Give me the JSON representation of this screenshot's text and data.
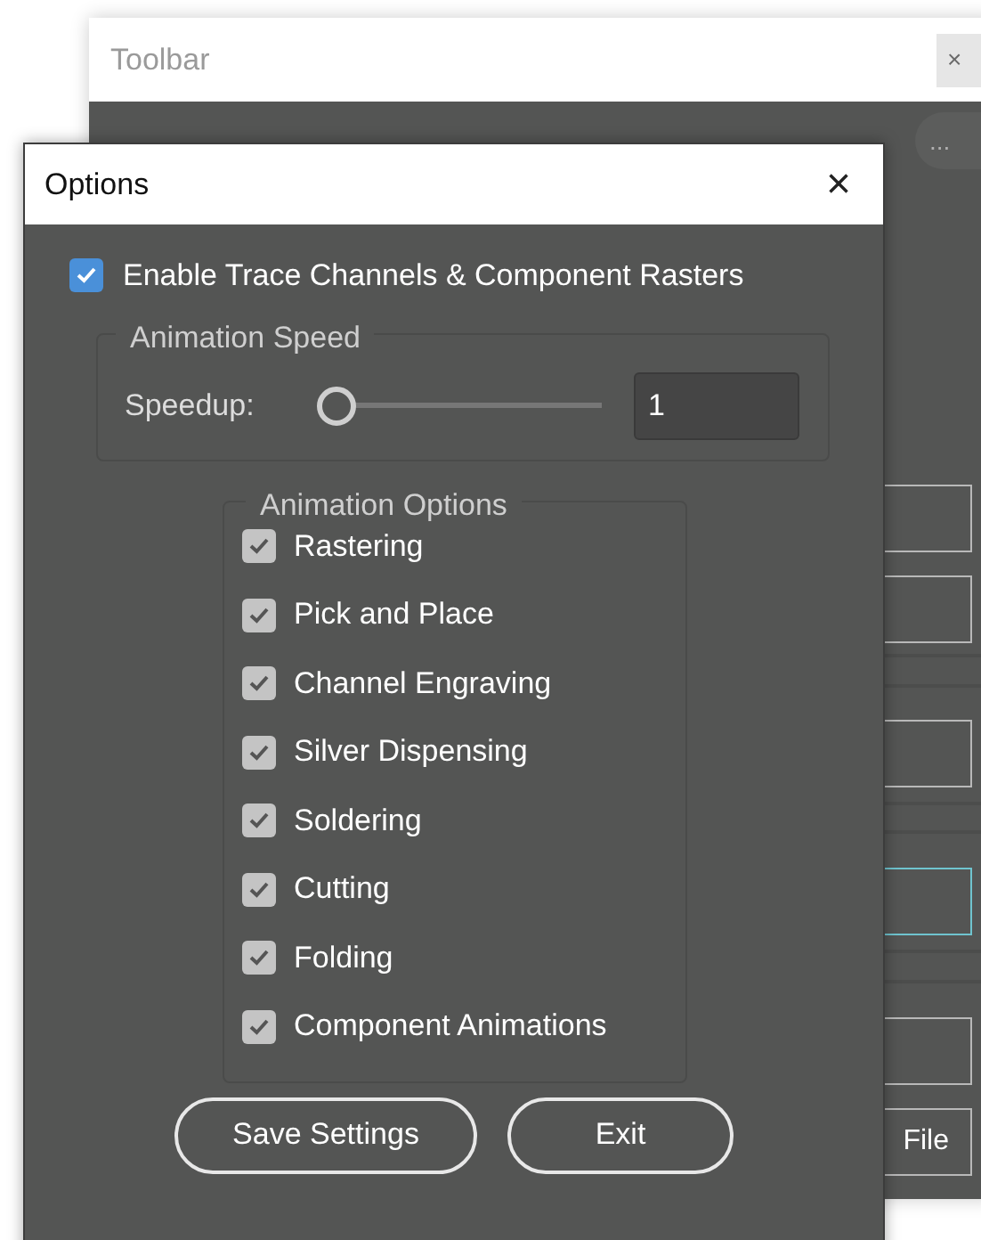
{
  "toolbar_window": {
    "title": "Toolbar",
    "close": "×",
    "more_button": "...",
    "buttons": [
      {
        "focused": false
      },
      {
        "focused": false
      },
      {
        "focused": false
      },
      {
        "focused": true
      },
      {
        "focused": false
      },
      {
        "focused": false,
        "label": "File"
      }
    ]
  },
  "options_window": {
    "title": "Options",
    "close": "×",
    "enable": {
      "label": "Enable Trace Channels & Component Rasters",
      "checked": true
    },
    "speed_group": {
      "legend": "Animation Speed",
      "label": "Speedup:",
      "level": 0,
      "value": "1"
    },
    "options_group": {
      "legend": "Animation Options",
      "items": [
        {
          "label": "Rastering",
          "checked": true
        },
        {
          "label": "Pick and Place",
          "checked": true
        },
        {
          "label": "Channel Engraving",
          "checked": true
        },
        {
          "label": "Silver Dispensing",
          "checked": true
        },
        {
          "label": "Soldering",
          "checked": true
        },
        {
          "label": "Cutting",
          "checked": true
        },
        {
          "label": "Folding",
          "checked": true
        },
        {
          "label": "Component Animations",
          "checked": true
        }
      ]
    },
    "buttons": [
      "Save Settings",
      "Exit"
    ]
  }
}
